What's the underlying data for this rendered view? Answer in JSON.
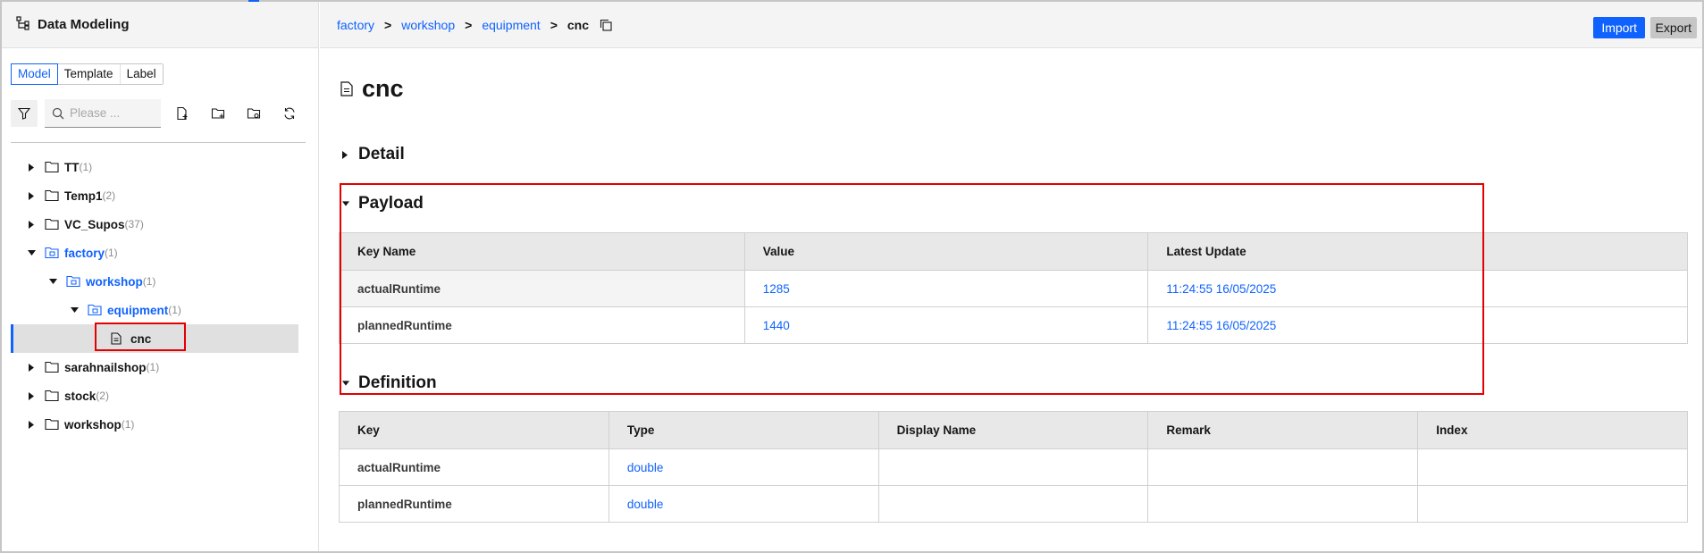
{
  "sidebar": {
    "title": "Data Modeling",
    "tabs": [
      "Model",
      "Template",
      "Label"
    ],
    "search_placeholder": "Please ...",
    "tree": [
      {
        "label": "TT",
        "count": "(1)"
      },
      {
        "label": "Temp1",
        "count": "(2)"
      },
      {
        "label": "VC_Supos",
        "count": "(37)"
      },
      {
        "label": "factory",
        "count": "(1)"
      },
      {
        "label": "workshop",
        "count": "(1)"
      },
      {
        "label": "equipment",
        "count": "(1)"
      },
      {
        "label": "cnc",
        "count": ""
      },
      {
        "label": "sarahnailshop",
        "count": "(1)"
      },
      {
        "label": "stock",
        "count": "(2)"
      },
      {
        "label": "workshop",
        "count": "(1)"
      }
    ]
  },
  "header": {
    "breadcrumb": [
      "factory",
      "workshop",
      "equipment",
      "cnc"
    ],
    "separator": ">",
    "import_label": "Import",
    "export_label": "Export"
  },
  "page": {
    "title": "cnc",
    "sections": {
      "detail": "Detail",
      "payload": "Payload",
      "definition": "Definition"
    }
  },
  "payload_table": {
    "columns": [
      "Key Name",
      "Value",
      "Latest Update"
    ],
    "rows": [
      [
        "actualRuntime",
        "1285",
        "11:24:55 16/05/2025"
      ],
      [
        "plannedRuntime",
        "1440",
        "11:24:55 16/05/2025"
      ]
    ]
  },
  "definition_table": {
    "columns": [
      "Key",
      "Type",
      "Display Name",
      "Remark",
      "Index"
    ],
    "rows": [
      [
        "actualRuntime",
        "double",
        "",
        "",
        ""
      ],
      [
        "plannedRuntime",
        "double",
        "",
        "",
        ""
      ]
    ]
  },
  "colors": {
    "accent": "#0f62fe",
    "highlight": "#e30000"
  }
}
